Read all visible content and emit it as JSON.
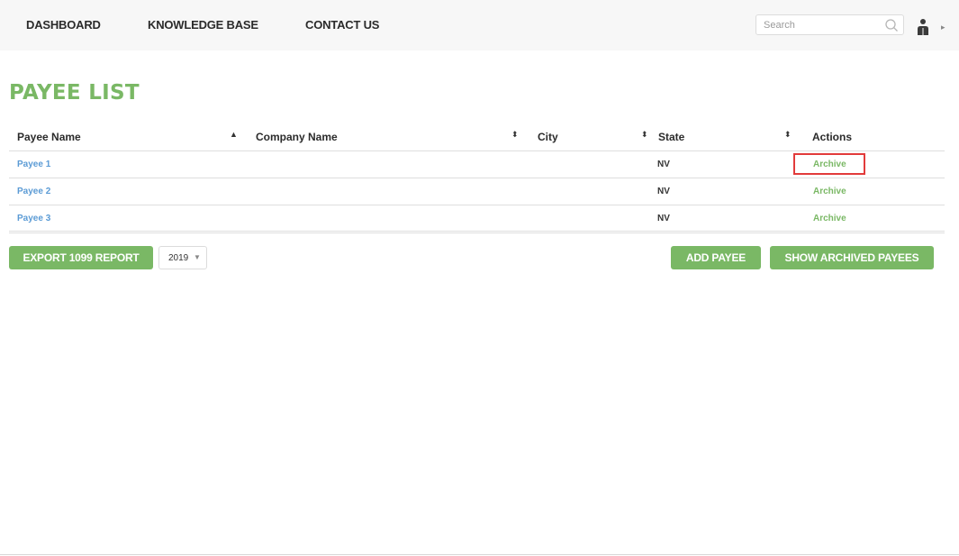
{
  "nav": {
    "items": [
      {
        "label": "DASHBOARD"
      },
      {
        "label": "KNOWLEDGE BASE"
      },
      {
        "label": "CONTACT US"
      }
    ],
    "search": {
      "placeholder": "Search",
      "value": ""
    },
    "icons": {
      "search": "search-icon",
      "user": "user-icon",
      "caret": "chevron-right-icon"
    }
  },
  "page": {
    "title": "PAYEE LIST"
  },
  "table": {
    "headers": [
      "Payee Name",
      "Company Name",
      "City",
      "State",
      "Actions"
    ],
    "sort_icons": {
      "payee_name": "▲",
      "company_name": "⬍",
      "city": "⬍",
      "state": "⬍"
    },
    "rows": [
      {
        "name": "Payee 1",
        "company": "",
        "city": "",
        "state": "NV",
        "action": "Archive"
      },
      {
        "name": "Payee 2",
        "company": "",
        "city": "",
        "state": "NV",
        "action": "Archive"
      },
      {
        "name": "Payee 3",
        "company": "",
        "city": "",
        "state": "NV",
        "action": "Archive"
      }
    ]
  },
  "actions": {
    "export_label": "EXPORT 1099 REPORT",
    "year_value": "2019",
    "add_label": "ADD PAYEE",
    "show_archived_label": "SHOW ARCHIVED PAYEES"
  },
  "colors": {
    "accent_green": "#7ab865",
    "link_blue": "#5b9bd5",
    "highlight_red": "#e23b3b"
  }
}
